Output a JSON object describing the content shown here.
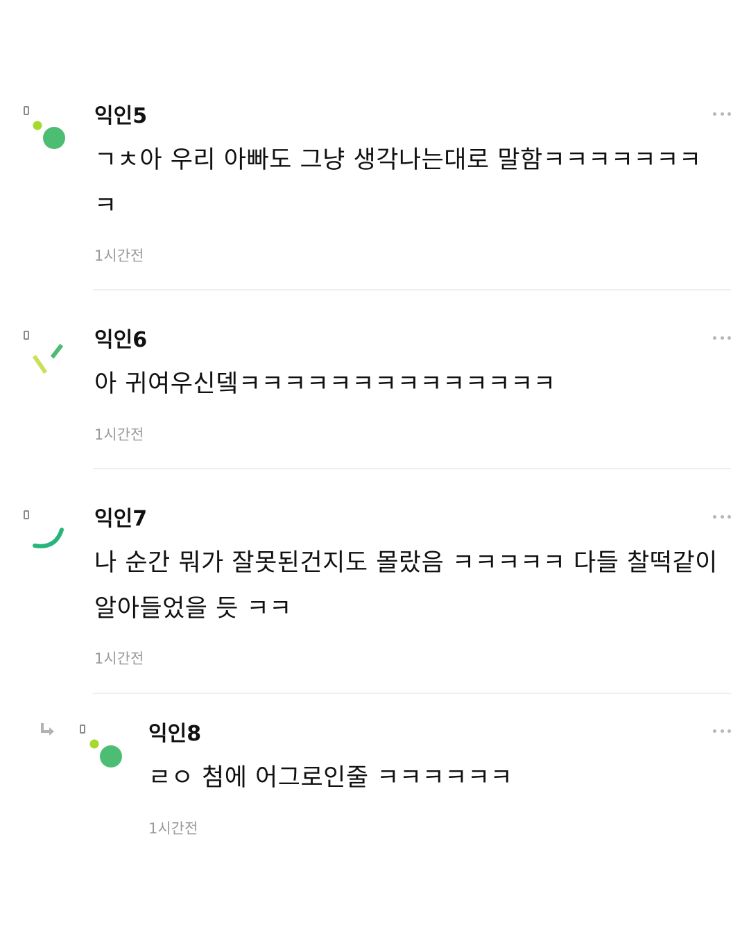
{
  "comments": [
    {
      "author": "익인5",
      "text": "ㄱㅊ아 우리 아빠도 그냥 생각나는대로 말함ㅋㅋㅋㅋㅋㅋㅋㅋ",
      "time": "1시간전",
      "avatar_icon": "dot-circle-avatar-icon"
    },
    {
      "author": "익인6",
      "text": "아 귀여우신뎈ㅋㅋㅋㅋㅋㅋㅋㅋㅋㅋㅋㅋㅋㅋ",
      "time": "1시간전",
      "avatar_icon": "twin-dash-avatar-icon"
    },
    {
      "author": "익인7",
      "text": "나 순간 뭐가 잘못된건지도 몰랐음 ㅋㅋㅋㅋㅋ 다들 찰떡같이 알아들었을 듯 ㅋㅋ",
      "time": "1시간전",
      "avatar_icon": "arc-smile-avatar-icon"
    }
  ],
  "reply": {
    "author": "익인8",
    "text": "ㄹㅇ 첨에 어그로인줄 ㅋㅋㅋㅋㅋㅋ",
    "time": "1시간전",
    "avatar_icon": "dot-circle-avatar-icon",
    "reply_icon": "reply-arrow-icon"
  },
  "colors": {
    "accent_green": "#4cbd72",
    "lime": "#a6d82e",
    "yellow_green": "#cbe05a",
    "teal_green": "#27b57a",
    "time_gray": "#9a9a9a",
    "more_gray": "#b7b7b7",
    "divider": "#efefef"
  }
}
